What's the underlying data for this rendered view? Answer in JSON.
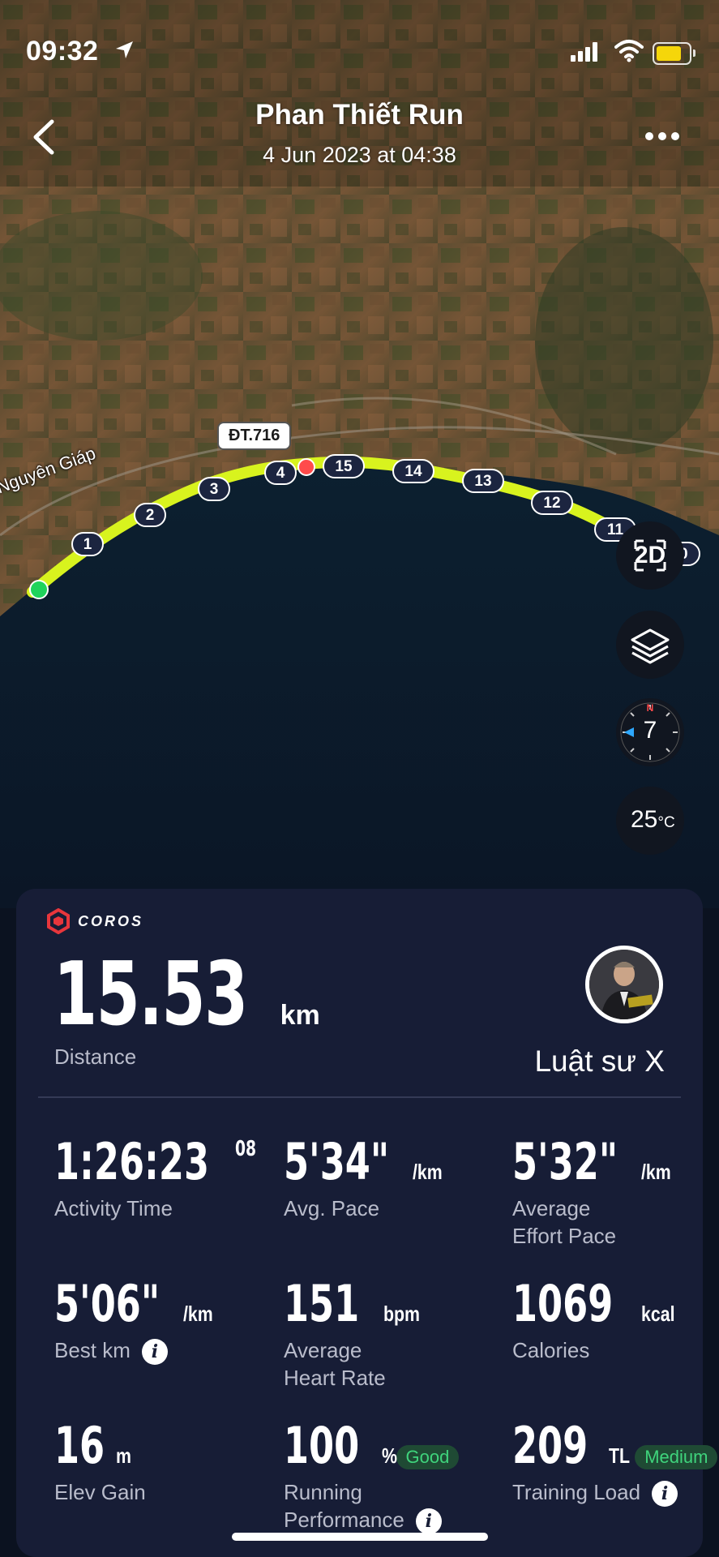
{
  "status_bar": {
    "time": "09:32"
  },
  "header": {
    "title": "Phan Thiết Run",
    "subtitle": "4 Jun 2023 at 04:38"
  },
  "map": {
    "road_label": "ĐT.716",
    "street_label": "Nguyên Giáp",
    "km_markers": [
      "1",
      "2",
      "3",
      "4",
      "15",
      "14",
      "13",
      "12",
      "11",
      "10"
    ],
    "controls": {
      "view_mode": "2D",
      "compass_value": "7",
      "compass_north": "N",
      "temperature": "25",
      "temperature_unit": "°C"
    }
  },
  "card": {
    "brand": "COROS",
    "distance": {
      "value": "15.53",
      "unit": "km",
      "label": "Distance"
    },
    "user": {
      "name": "Luật sư X"
    },
    "stats": {
      "activity_time": {
        "value": "1:26:23",
        "sup": "08",
        "label": "Activity Time"
      },
      "avg_pace": {
        "value": "5'34\"",
        "unit": "/km",
        "label": "Avg. Pace"
      },
      "effort_pace": {
        "value": "5'32\"",
        "unit": "/km",
        "label_1": "Average",
        "label_2": "Effort Pace"
      },
      "best_km": {
        "value": "5'06\"",
        "unit": "/km",
        "label": "Best km"
      },
      "heart_rate": {
        "value": "151",
        "unit": "bpm",
        "label_1": "Average",
        "label_2": "Heart Rate"
      },
      "calories": {
        "value": "1069",
        "unit": "kcal",
        "label": "Calories"
      },
      "elev_gain": {
        "value": "16",
        "unit": "m",
        "label": "Elev Gain"
      },
      "running_performance": {
        "value": "100",
        "unit": "%",
        "badge": "Good",
        "label_1": "Running",
        "label_2": "Performance"
      },
      "training_load": {
        "value": "209",
        "unit": "TL",
        "badge": "Medium",
        "label": "Training Load"
      }
    }
  },
  "colors": {
    "route": "#d8f31e",
    "start": "#1fd35b",
    "current": "#ff4b4b",
    "badge_text": "#3fd47c",
    "card_bg": "#171d36"
  }
}
